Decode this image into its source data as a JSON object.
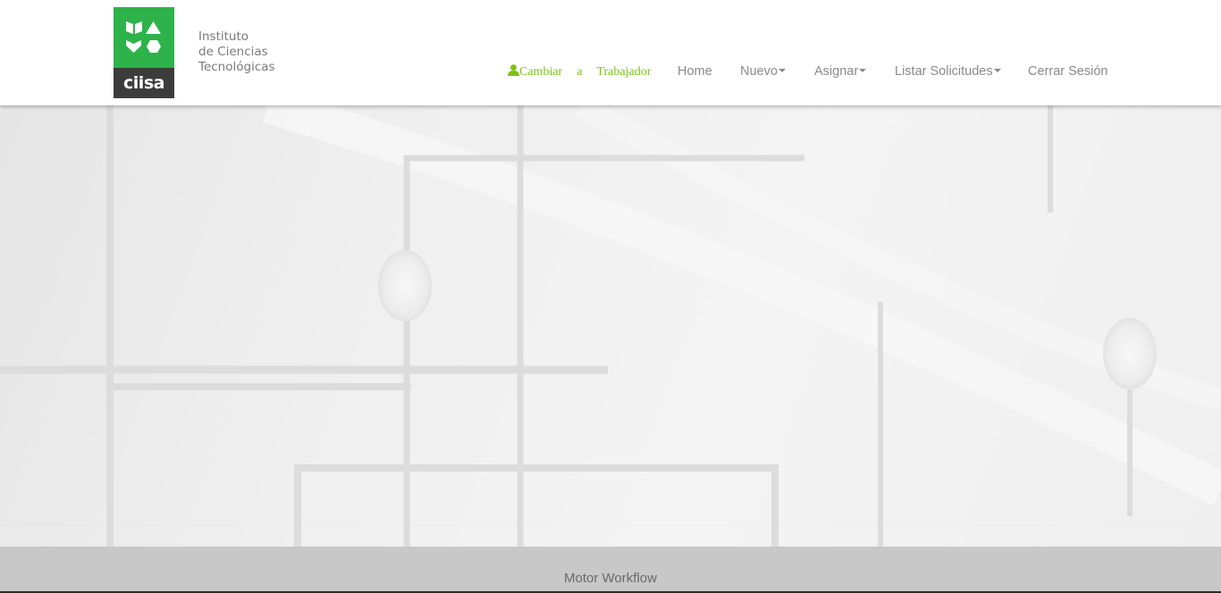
{
  "brand": {
    "logo_word": "ciisa",
    "name_lines": [
      "Instituto",
      "de Ciencias",
      "Tecnológicas"
    ],
    "green": "#2db34a",
    "dark": "#3c3c3c"
  },
  "nav": {
    "switch_icon": "user-icon",
    "switch_words": [
      "Cambiar",
      "a",
      "Trabajador"
    ],
    "switch_color": "#7cc313",
    "items": [
      {
        "label": "Home",
        "dropdown": false
      },
      {
        "label": "Nuevo",
        "dropdown": true
      },
      {
        "label": "Asignar",
        "dropdown": true
      },
      {
        "label": "Listar Solicitudes",
        "dropdown": true
      },
      {
        "label": "Cerrar Sesión",
        "dropdown": false
      }
    ]
  },
  "footer": {
    "text": "Motor Workflow"
  }
}
